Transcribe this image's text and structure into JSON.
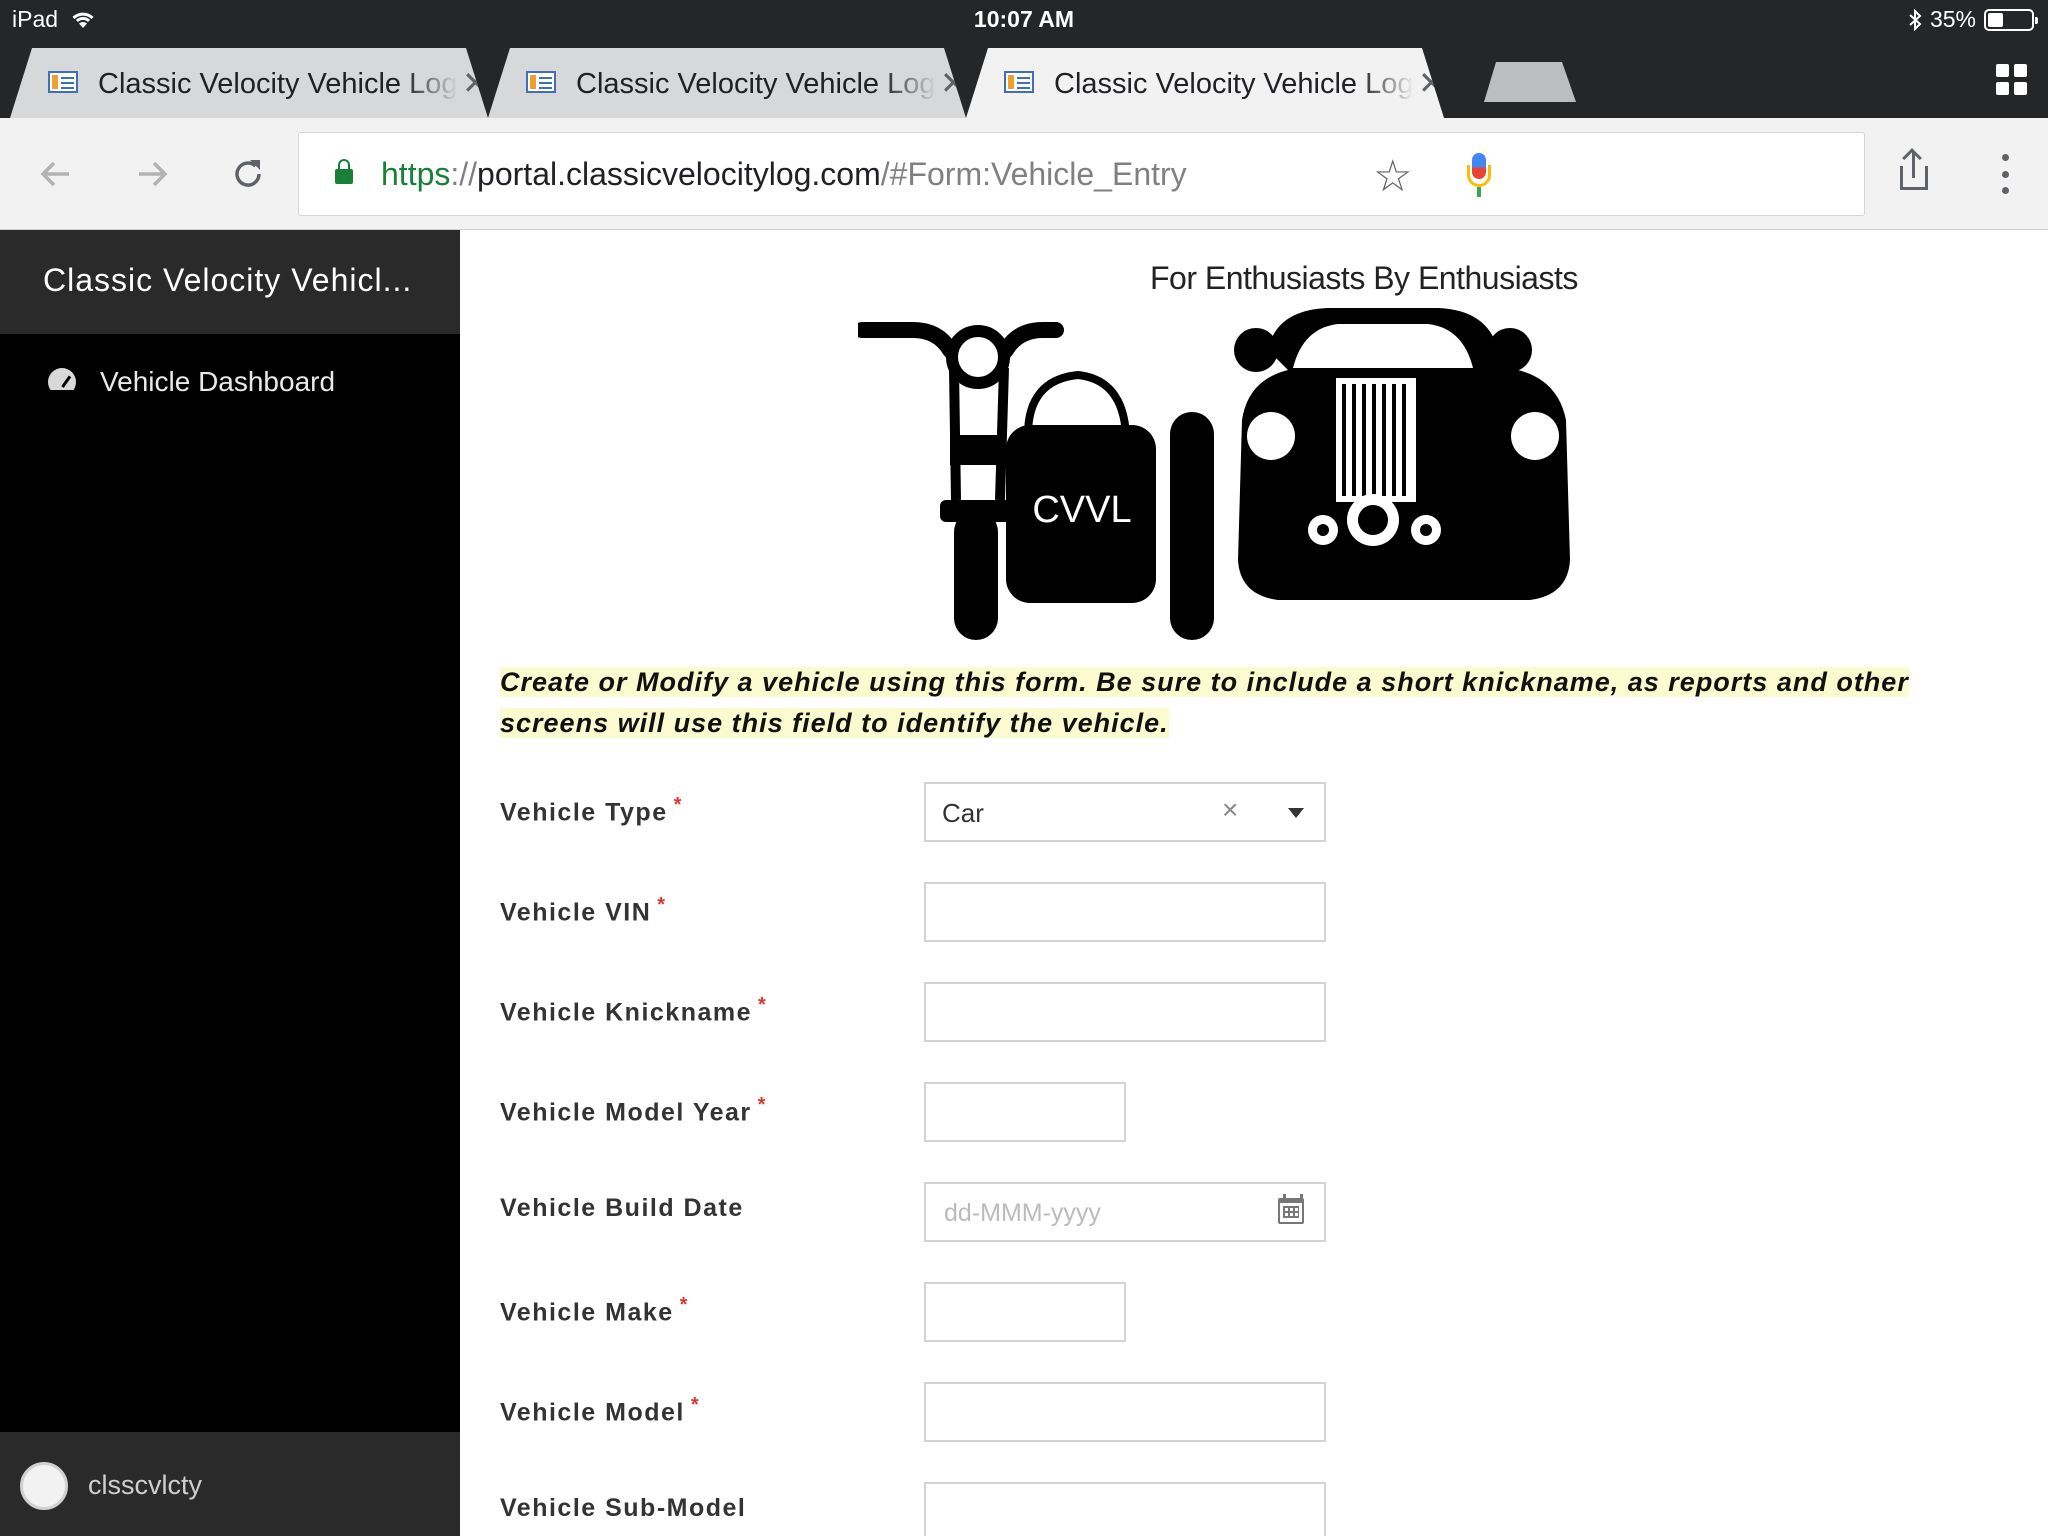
{
  "status_bar": {
    "device": "iPad",
    "time": "10:07 AM",
    "battery": "35%",
    "battery_level": 0.35
  },
  "browser": {
    "tabs": [
      {
        "title": "Classic Velocity Vehicle Log",
        "active": false
      },
      {
        "title": "Classic Velocity Vehicle Log",
        "active": false
      },
      {
        "title": "Classic Velocity Vehicle Log",
        "active": true
      }
    ],
    "url": {
      "scheme": "https",
      "separator": "://",
      "host": "portal.classicvelocitylog.com",
      "path": "/#Form:Vehicle_Entry"
    }
  },
  "sidebar": {
    "app_title": "Classic Velocity Vehicl...",
    "items": [
      {
        "label": "Vehicle Dashboard",
        "icon": "dashboard-gauge-icon"
      }
    ],
    "user": {
      "name": "clsscvlcty"
    }
  },
  "header": {
    "tagline": "For Enthusiasts By Enthusiasts",
    "logo_text": "CVVL"
  },
  "notice": "Create or Modify a vehicle using this form. Be sure to include a short knickname, as reports and other screens will use this field to identify the vehicle.",
  "form": {
    "fields": [
      {
        "label": "Vehicle Type",
        "required": true,
        "type": "select",
        "value": "Car"
      },
      {
        "label": "Vehicle VIN",
        "required": true,
        "type": "text",
        "value": ""
      },
      {
        "label": "Vehicle Knickname",
        "required": true,
        "type": "text",
        "value": ""
      },
      {
        "label": "Vehicle Model Year",
        "required": true,
        "type": "text",
        "value": ""
      },
      {
        "label": "Vehicle Build Date",
        "required": false,
        "type": "date",
        "placeholder": "dd-MMM-yyyy"
      },
      {
        "label": "Vehicle Make",
        "required": true,
        "type": "text",
        "value": ""
      },
      {
        "label": "Vehicle Model",
        "required": true,
        "type": "text",
        "value": ""
      },
      {
        "label": "Vehicle Sub-Model",
        "required": false,
        "type": "text",
        "value": ""
      }
    ],
    "required_marker": "*"
  },
  "colors": {
    "url_scheme": "#188038",
    "notice_highlight": "#fbfbd0",
    "required": "#dd3333",
    "sidebar_bg": "#000000"
  }
}
